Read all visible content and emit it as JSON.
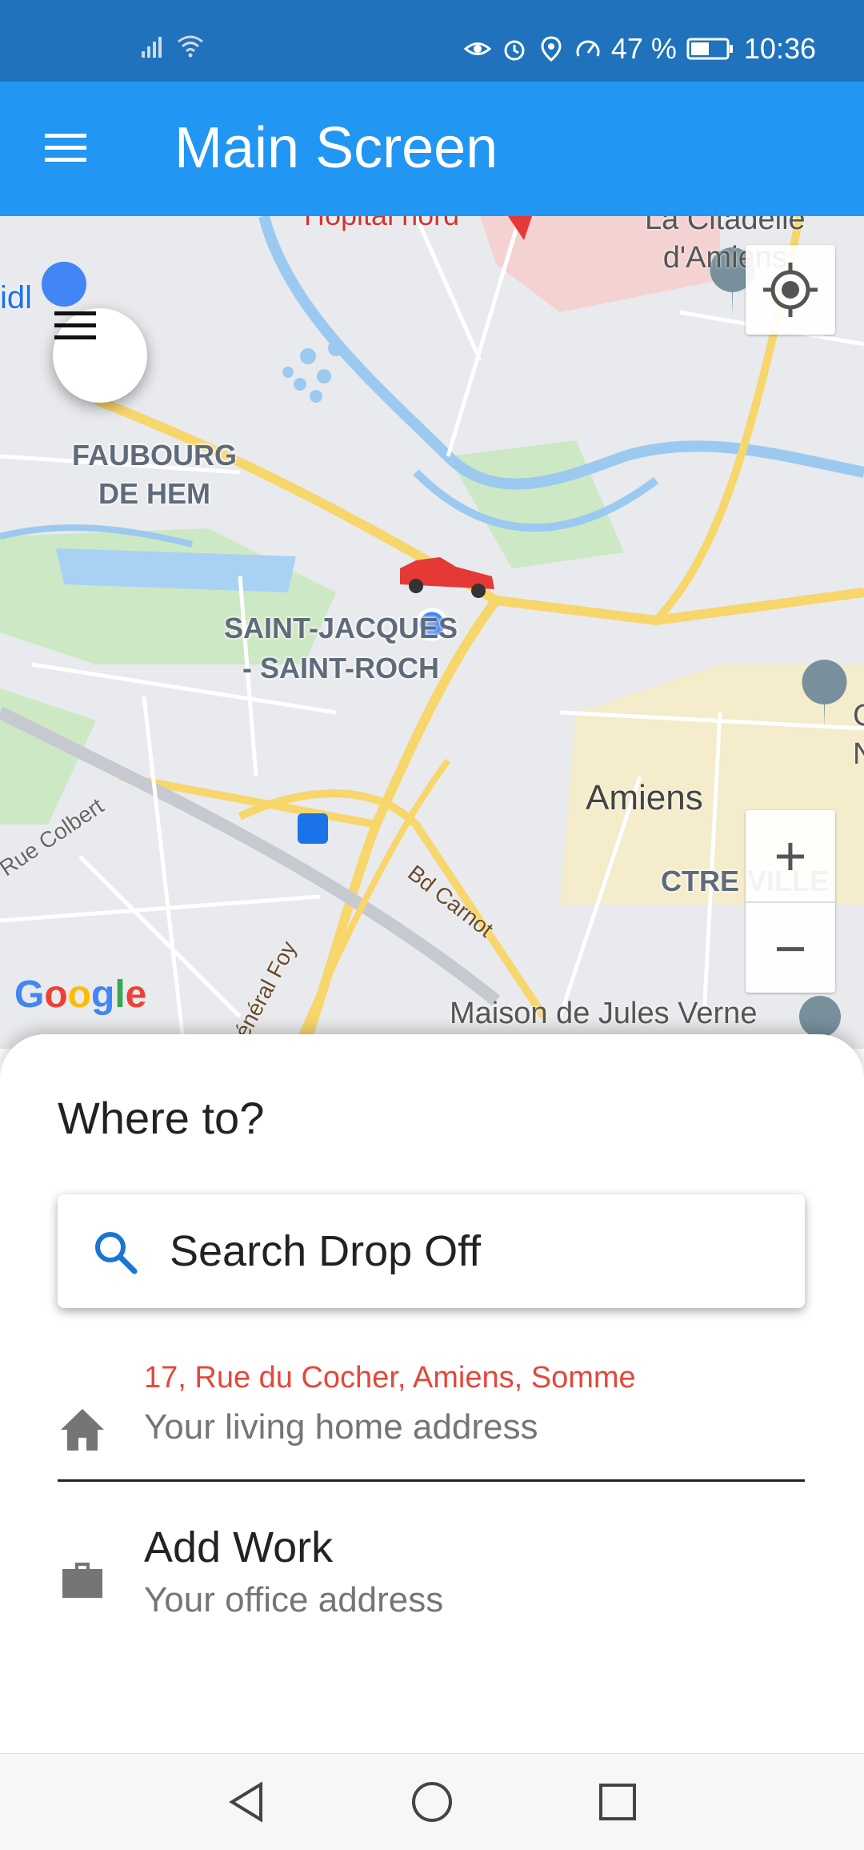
{
  "status_bar": {
    "battery_text": "47 %",
    "time": "10:36",
    "icons": [
      "signal-icon",
      "wifi-icon",
      "eye-icon",
      "alarm-icon",
      "location-icon",
      "speed-icon",
      "battery-icon"
    ]
  },
  "app_bar": {
    "title": "Main Screen",
    "menu_icon": "hamburger-menu-icon"
  },
  "map": {
    "labels": {
      "faubourg": "FAUBOURG\nDE HEM",
      "saint_jacques": "SAINT-JACQUES\n- SAINT-ROCH",
      "amiens": "Amiens",
      "ctre_ville": "CTRE VILLE",
      "hopital": "Hôpital nord",
      "citadelle": "La Citadelle\nd'Amiens",
      "rue_colbert": "Rue Colbert",
      "bd_carnot": "Bd Carnot",
      "general_foy": "Général Foy",
      "jules_verne": "Maison de Jules Verne",
      "aldi": "idl",
      "right_edge": "C\nN"
    },
    "google": "Google",
    "zoom_in": "+",
    "zoom_out": "−"
  },
  "sheet": {
    "heading": "Where to?",
    "search_placeholder": "Search Drop Off",
    "home": {
      "address": "17, Rue du Cocher, Amiens, Somme",
      "subtitle": "Your living home address"
    },
    "work": {
      "title": "Add Work",
      "subtitle": "Your office address"
    }
  },
  "colors": {
    "status_bar": "#1f72bb",
    "app_bar": "#2196f3",
    "accent_red": "#e5473b",
    "search_icon": "#1976d2"
  }
}
